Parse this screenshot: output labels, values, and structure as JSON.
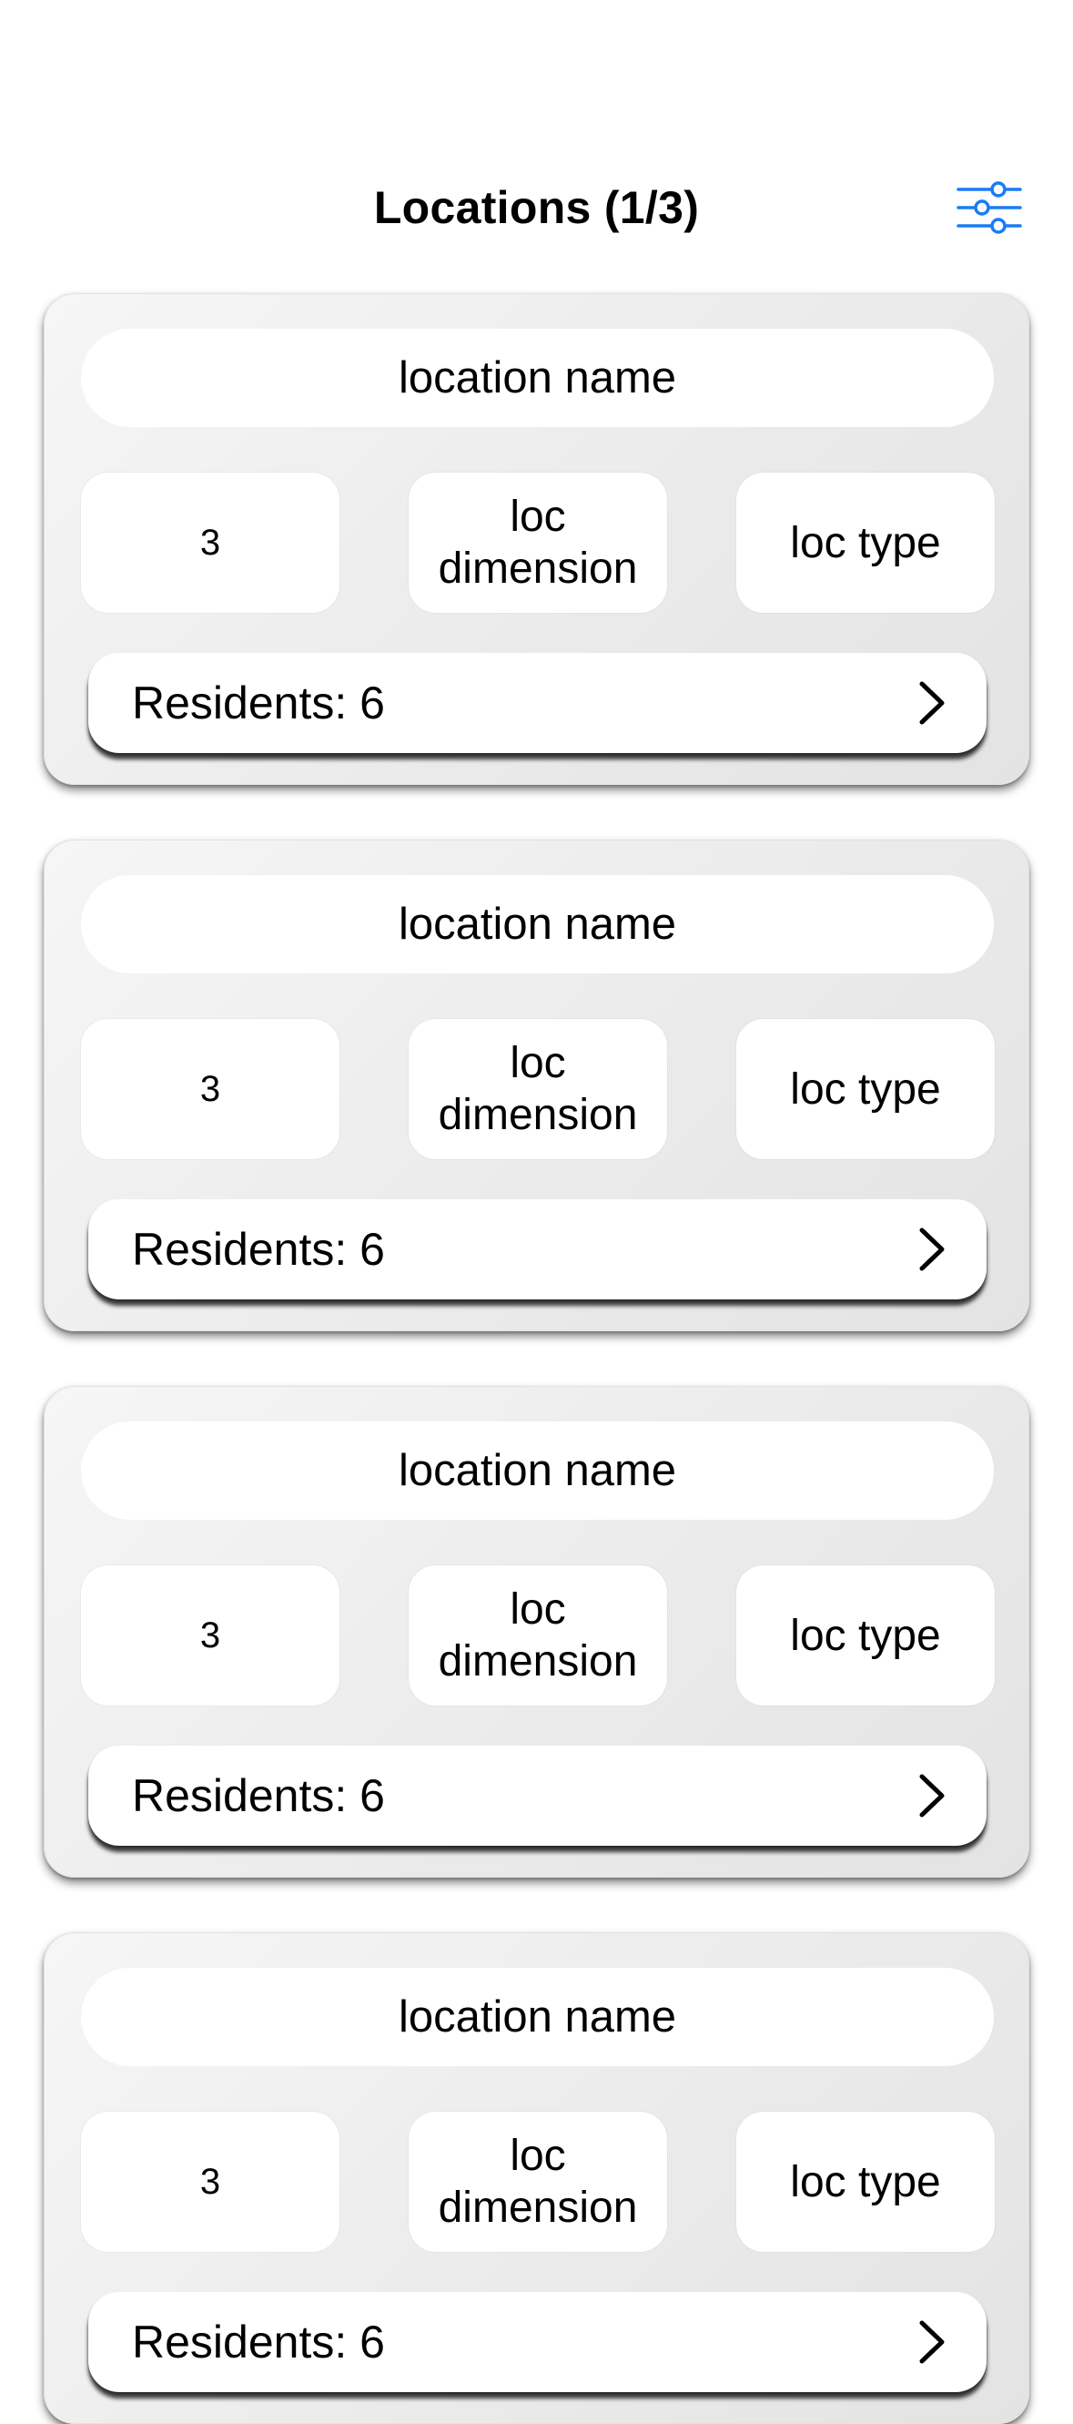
{
  "header": {
    "title": "Locations (1/3)",
    "filter_icon": "sliders-icon"
  },
  "colors": {
    "accent": "#1a7cf5",
    "card_bg": "#ececec",
    "chip_bg": "#ffffff"
  },
  "locations": [
    {
      "name": "location name",
      "count": "3",
      "dimension": "loc dimension",
      "type": "loc type",
      "residents_label": "Residents: 6"
    },
    {
      "name": "location name",
      "count": "3",
      "dimension": "loc dimension",
      "type": "loc type",
      "residents_label": "Residents: 6"
    },
    {
      "name": "location name",
      "count": "3",
      "dimension": "loc dimension",
      "type": "loc type",
      "residents_label": "Residents: 6"
    },
    {
      "name": "location name",
      "count": "3",
      "dimension": "loc dimension",
      "type": "loc type",
      "residents_label": "Residents: 6"
    }
  ]
}
